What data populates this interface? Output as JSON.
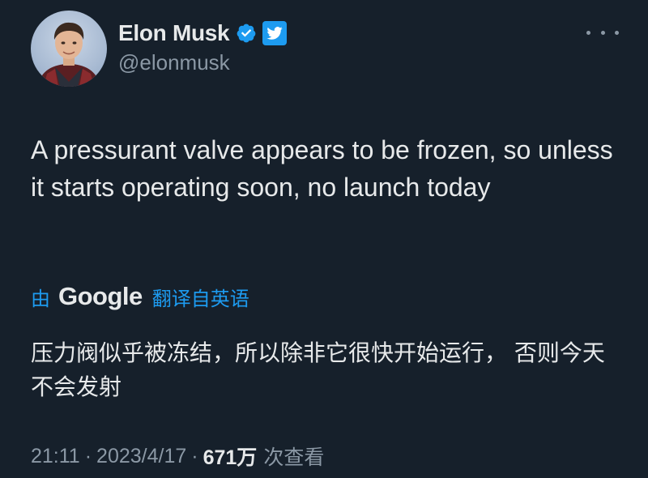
{
  "author": {
    "display_name": "Elon Musk",
    "handle": "@elonmusk",
    "verified": true
  },
  "tweet": {
    "text": "A pressurant valve appears to be frozen, so unless it starts operating soon, no launch today"
  },
  "translation": {
    "by_label": "由",
    "provider": "Google",
    "action_label": "翻译自英语",
    "translated_text": "压力阀似乎被冻结，所以除非它很快开始运行， 否则今天不会发射"
  },
  "meta": {
    "time": "21:11",
    "separator": "·",
    "date": "2023/4/17",
    "views": "671万",
    "views_label": "次查看"
  },
  "colors": {
    "background": "#16202b",
    "accent": "#1d9bf0",
    "primary_text": "#e7e9ea",
    "secondary_text": "#8b98a5"
  },
  "icons": {
    "verified": "verified-badge-icon",
    "twitter": "twitter-bird-icon",
    "more": "more-options-icon"
  }
}
